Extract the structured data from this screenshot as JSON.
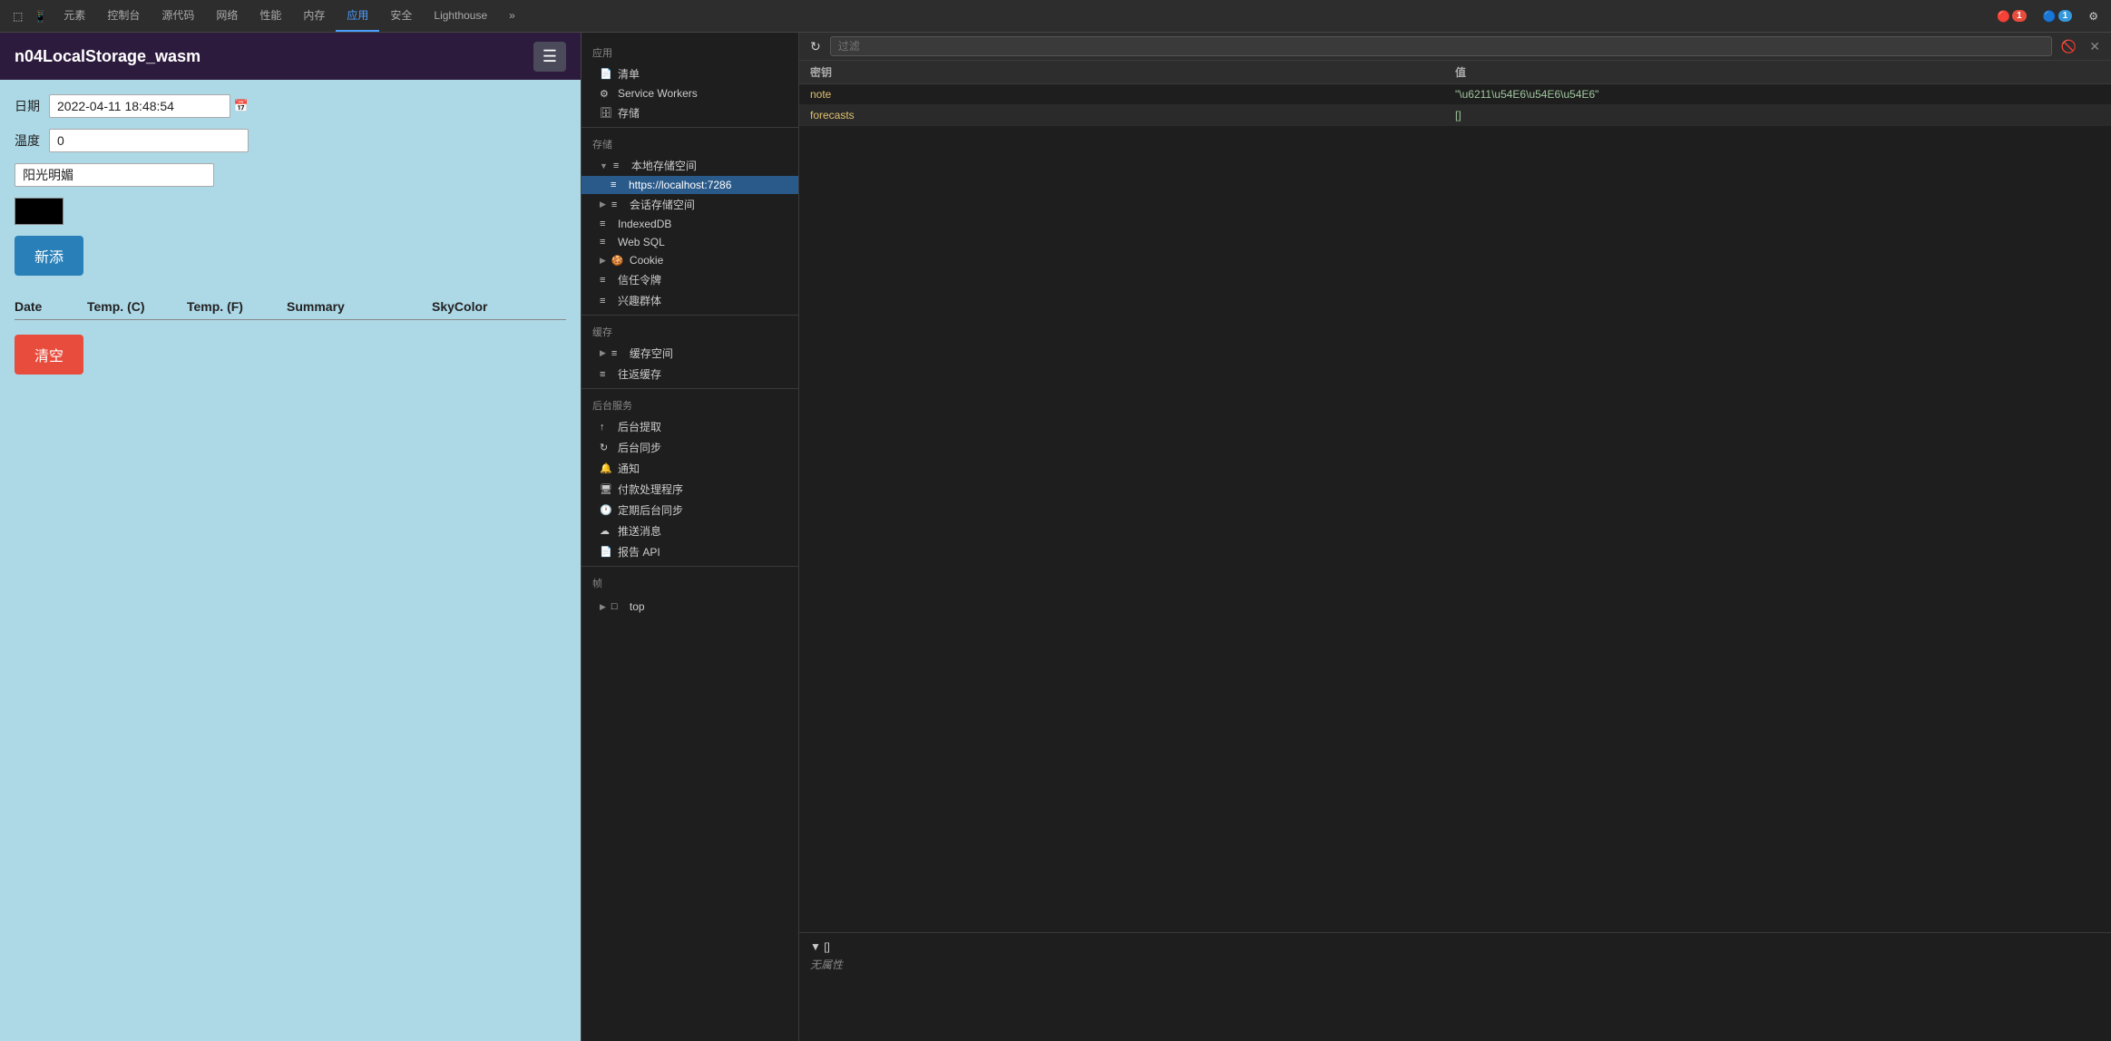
{
  "browser": {
    "devtools_tabs": [
      {
        "label": "元素",
        "active": false
      },
      {
        "label": "控制台",
        "active": false
      },
      {
        "label": "源代码",
        "active": false
      },
      {
        "label": "网络",
        "active": false
      },
      {
        "label": "性能",
        "active": false
      },
      {
        "label": "内存",
        "active": false
      },
      {
        "label": "应用",
        "active": true
      },
      {
        "label": "安全",
        "active": false
      },
      {
        "label": "Lighthouse",
        "active": false
      },
      {
        "label": "»",
        "active": false
      }
    ],
    "topbar_icons": [
      {
        "label": "cursor-icon"
      },
      {
        "label": "device-icon"
      }
    ],
    "error_badge": "1",
    "warning_badge": "1",
    "settings_icon": "⚙"
  },
  "app": {
    "title": "n04LocalStorage_wasm",
    "hamburger_label": "☰",
    "form": {
      "date_label": "日期",
      "date_value": "2022-04-11 18:48:54",
      "temp_label": "温度",
      "temp_value": "0",
      "summary_value": "阳光明媚",
      "add_button": "新添",
      "clear_button": "清空"
    },
    "table": {
      "headers": [
        "Date",
        "Temp. (C)",
        "Temp. (F)",
        "Summary",
        "SkyColor"
      ]
    }
  },
  "devtools": {
    "tabs": [
      {
        "label": "元素"
      },
      {
        "label": "控制台"
      },
      {
        "label": "源代码"
      },
      {
        "label": "网络"
      },
      {
        "label": "性能"
      },
      {
        "label": "内存"
      },
      {
        "label": "应用",
        "active": true
      },
      {
        "label": "安全"
      },
      {
        "label": "Lighthouse"
      },
      {
        "label": "»"
      }
    ],
    "sidebar": {
      "sections": [
        {
          "label": "应用",
          "items": [
            {
              "label": "清单",
              "icon": "📄",
              "indent": 1
            },
            {
              "label": "Service Workers",
              "icon": "⚙",
              "indent": 1
            },
            {
              "label": "存储",
              "icon": "🗄",
              "indent": 1
            }
          ]
        },
        {
          "label": "存储",
          "items": [
            {
              "label": "本地存储空间",
              "icon": "▼",
              "expandable": true,
              "indent": 1
            },
            {
              "label": "https://localhost:7286",
              "icon": "≡",
              "indent": 2,
              "active": true
            },
            {
              "label": "会话存储空间",
              "icon": "▶",
              "expandable": true,
              "indent": 1
            },
            {
              "label": "IndexedDB",
              "icon": "≡",
              "indent": 1
            },
            {
              "label": "Web SQL",
              "icon": "≡",
              "indent": 1
            },
            {
              "label": "Cookie",
              "icon": "▶",
              "expandable": true,
              "indent": 1
            },
            {
              "label": "信任令牌",
              "icon": "≡",
              "indent": 1
            },
            {
              "label": "兴趣群体",
              "icon": "≡",
              "indent": 1
            }
          ]
        },
        {
          "label": "缓存",
          "items": [
            {
              "label": "缓存空间",
              "icon": "▶",
              "expandable": true,
              "indent": 1
            },
            {
              "label": "往返缓存",
              "icon": "≡",
              "indent": 1
            }
          ]
        },
        {
          "label": "后台服务",
          "items": [
            {
              "label": "后台提取",
              "icon": "↑",
              "indent": 1
            },
            {
              "label": "后台同步",
              "icon": "↻",
              "indent": 1
            },
            {
              "label": "通知",
              "icon": "🔔",
              "indent": 1
            },
            {
              "label": "付款处理程序",
              "icon": "🖥",
              "indent": 1
            },
            {
              "label": "定期后台同步",
              "icon": "🕐",
              "indent": 1
            },
            {
              "label": "推送消息",
              "icon": "☁",
              "indent": 1
            },
            {
              "label": "报告 API",
              "icon": "📄",
              "indent": 1
            }
          ]
        },
        {
          "label": "帧",
          "items": [
            {
              "label": "top",
              "icon": "▶",
              "expandable": true,
              "indent": 1
            }
          ]
        }
      ]
    },
    "filter": {
      "placeholder": "过滤"
    },
    "table": {
      "columns": [
        "密钥",
        "值"
      ],
      "rows": [
        {
          "key": "note",
          "value": "\"\\u6211\\u54E6\\u54E6\\u54E6\""
        },
        {
          "key": "forecasts",
          "value": "[]"
        }
      ]
    },
    "preview": {
      "label": "▼ []",
      "content": "无属性"
    },
    "bottom_label": "top"
  }
}
